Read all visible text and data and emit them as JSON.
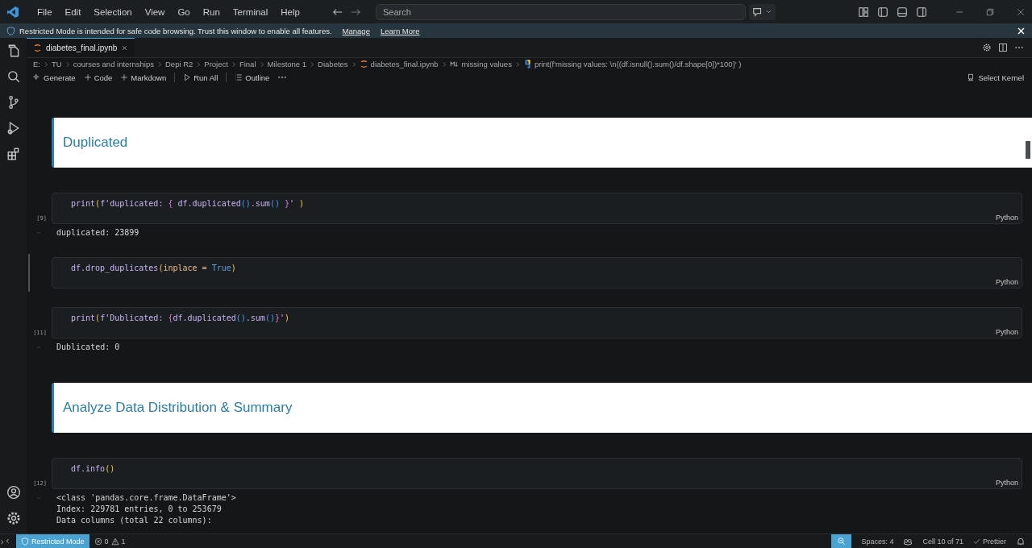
{
  "title_bar": {
    "menu": [
      "File",
      "Edit",
      "Selection",
      "View",
      "Go",
      "Run",
      "Terminal",
      "Help"
    ],
    "search": {
      "placeholder": "Search"
    }
  },
  "banner": {
    "text": "Restricted Mode is intended for safe code browsing. Trust this window to enable all features.",
    "links": [
      "Manage",
      "Learn More"
    ]
  },
  "tabs": [
    {
      "label": "diabetes_final.ipynb",
      "selected": true
    }
  ],
  "breadcrumbs": [
    {
      "kind": "folder",
      "label": "E:"
    },
    {
      "kind": "folder",
      "label": "TU"
    },
    {
      "kind": "folder",
      "label": "courses and internships"
    },
    {
      "kind": "folder",
      "label": "Depi R2"
    },
    {
      "kind": "folder",
      "label": "Project"
    },
    {
      "kind": "folder",
      "label": "Final"
    },
    {
      "kind": "folder",
      "label": "Milestone 1"
    },
    {
      "kind": "folder",
      "label": "Diabetes"
    },
    {
      "kind": "notebook",
      "label": "diabetes_final.ipynb"
    },
    {
      "kind": "markdown",
      "label": "missing values"
    },
    {
      "kind": "python",
      "label": "print(f'missing values: \\n{(df.isnull().sum()/df.shape[0])*100}' )"
    }
  ],
  "toolbar": {
    "actions": [
      {
        "kind": "generate",
        "label": "Generate"
      },
      {
        "kind": "add",
        "label": "Code"
      },
      {
        "kind": "add",
        "label": "Markdown"
      },
      {
        "kind": "run",
        "label": "Run All"
      },
      {
        "kind": "outline",
        "label": "Outline"
      }
    ],
    "kernel": "Select Kernel"
  },
  "cells": [
    {
      "kind": "markdown",
      "heading": "Duplicated"
    },
    {
      "kind": "code",
      "exec_count": "[9]",
      "language": "Python",
      "selected": false,
      "tokens": [
        {
          "kind": "name",
          "text": "print"
        },
        {
          "kind": "paren",
          "text": "("
        },
        {
          "kind": "name",
          "text": "f'duplicated: "
        },
        {
          "kind": "brace",
          "text": "{"
        },
        {
          "kind": "name",
          "text": " df.duplicated"
        },
        {
          "kind": "call",
          "text": "()"
        },
        {
          "kind": "name",
          "text": ".sum"
        },
        {
          "kind": "call",
          "text": "()"
        },
        {
          "kind": "brace",
          "text": " }"
        },
        {
          "kind": "name",
          "text": "' "
        },
        {
          "kind": "paren",
          "text": ")"
        }
      ]
    },
    {
      "kind": "output",
      "lines": [
        "duplicated: 23899"
      ]
    },
    {
      "kind": "code",
      "language": "Python",
      "selected": true,
      "tokens": [
        {
          "kind": "name",
          "text": "df.drop_duplicates"
        },
        {
          "kind": "paren",
          "text": "("
        },
        {
          "kind": "param",
          "text": "inplace = "
        },
        {
          "kind": "keyword",
          "text": "True"
        },
        {
          "kind": "paren",
          "text": ")"
        }
      ]
    },
    {
      "kind": "code",
      "exec_count": "[11]",
      "language": "Python",
      "selected": false,
      "tokens": [
        {
          "kind": "name",
          "text": "print"
        },
        {
          "kind": "paren",
          "text": "("
        },
        {
          "kind": "name",
          "text": "f'Dublicated: "
        },
        {
          "kind": "brace",
          "text": "{"
        },
        {
          "kind": "name",
          "text": "df.duplicated"
        },
        {
          "kind": "call",
          "text": "()"
        },
        {
          "kind": "name",
          "text": ".sum"
        },
        {
          "kind": "call",
          "text": "()"
        },
        {
          "kind": "brace",
          "text": "}"
        },
        {
          "kind": "name",
          "text": "'"
        },
        {
          "kind": "paren",
          "text": ")"
        }
      ]
    },
    {
      "kind": "output",
      "lines": [
        "Dublicated: 0"
      ]
    },
    {
      "kind": "markdown",
      "heading": "Analyze Data Distribution & Summary"
    },
    {
      "kind": "code",
      "exec_count": "[12]",
      "language": "Python",
      "selected": false,
      "tokens": [
        {
          "kind": "name",
          "text": "df.info"
        },
        {
          "kind": "paren",
          "text": "()"
        }
      ]
    },
    {
      "kind": "output",
      "lines": [
        "<class 'pandas.core.frame.DataFrame'>",
        "Index: 229781 entries, 0 to 253679",
        "Data columns (total 22 columns):"
      ]
    }
  ],
  "status_bar": {
    "mode": "Restricted Mode",
    "errors": "0",
    "warnings": "1",
    "spaces": "Spaces: 4",
    "cell": "Cell 10 of 71",
    "formatter": "Prettier"
  }
}
